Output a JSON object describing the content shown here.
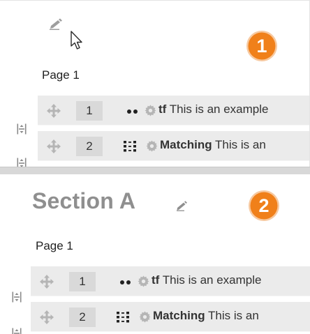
{
  "colors": {
    "badge_orange": "#f0801a",
    "icon_grey": "#b5b5b5",
    "section_title": "#8f8f8f",
    "row_bg": "#ebebeb",
    "slot_bg": "#d9d9d9"
  },
  "steps": [
    {
      "number": "1",
      "icon": "numbered-badge"
    },
    {
      "number": "2",
      "icon": "numbered-badge"
    }
  ],
  "top_panel": {
    "edit_icon": "pencil-icon",
    "cursor_icon": "mouse-pointer-icon",
    "page_label": "Page 1",
    "slots": [
      {
        "number": "1",
        "type_icon": "true-false-dots-icon",
        "type": "tf",
        "text": " This is an example"
      },
      {
        "number": "2",
        "type_icon": "matching-grid-icon",
        "type": "Matching",
        "text": " This is an"
      }
    ]
  },
  "bottom_panel": {
    "section_title": "Section A",
    "edit_icon": "pencil-icon",
    "page_label": "Page 1",
    "slots": [
      {
        "number": "1",
        "type_icon": "true-false-dots-icon",
        "type": "tf",
        "text": " This is an example"
      },
      {
        "number": "2",
        "type_icon": "matching-grid-icon",
        "type": "Matching",
        "text": " This is an"
      }
    ]
  }
}
